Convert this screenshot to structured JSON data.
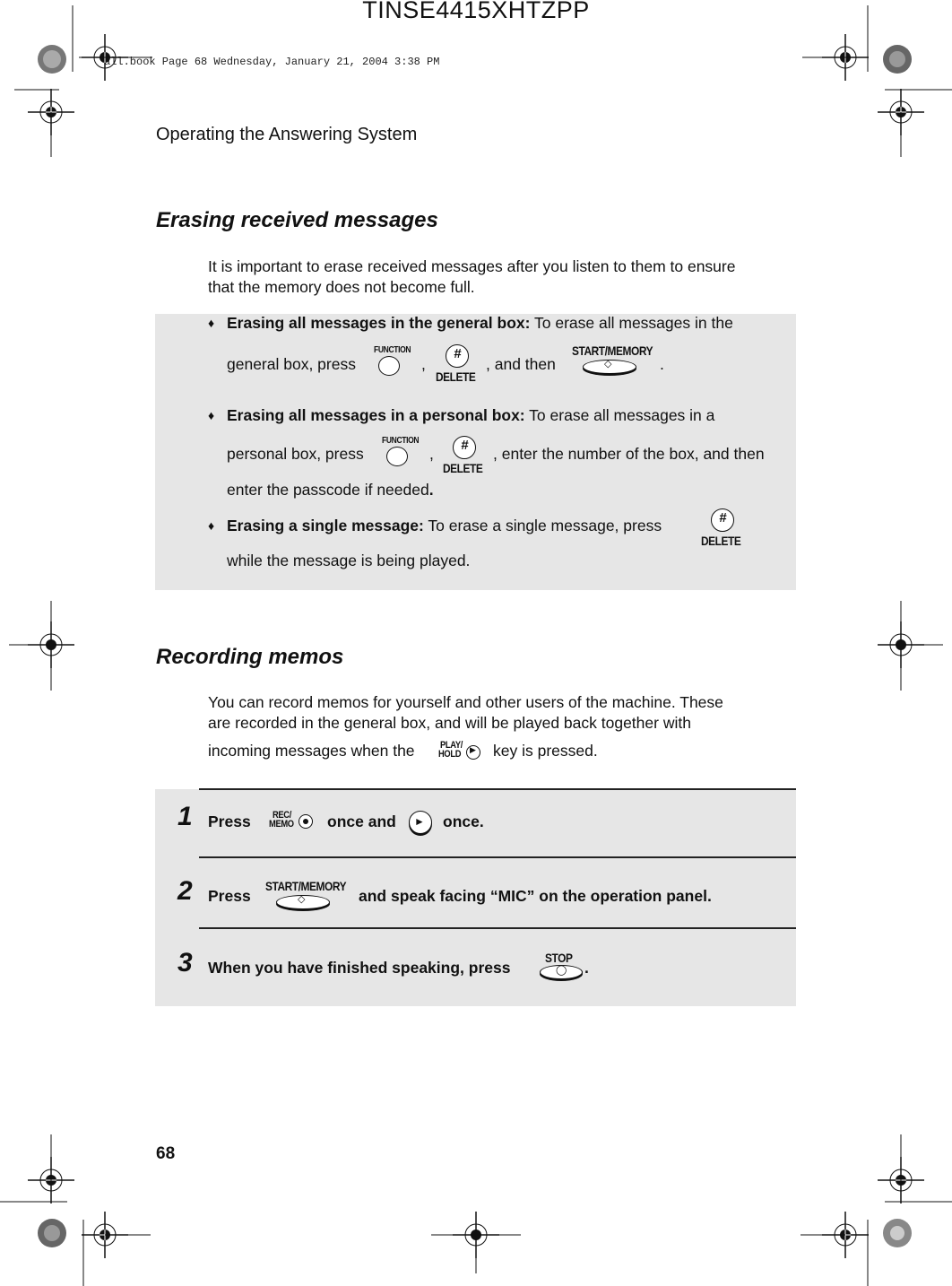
{
  "job_id": "TINSE4415XHTZPP",
  "book_line": "all.book  Page 68  Wednesday, January 21, 2004  3:38 PM",
  "running_head": "Operating the Answering System",
  "page_number": "68",
  "erasing": {
    "title": "Erasing received messages",
    "intro_line1": "It is important to erase received messages after you listen to them to ensure",
    "intro_line2": "that the memory does not become full.",
    "bullets": [
      {
        "bold": "Erasing all messages in the general box:",
        "text1": " To erase all messages in the",
        "text2": "general box, press",
        "sep1": ",",
        "sep2": ", and then",
        "end": "."
      },
      {
        "bold": "Erasing all messages in a personal box:",
        "text1": " To erase all messages in a",
        "text2": "personal box, press",
        "sep1": ",",
        "sep2": ", enter the number of the box, and then",
        "text3a": "enter the passcode if needed",
        "text3b": "."
      },
      {
        "bold": "Erasing a single message:",
        "text1": " To erase a single message, press",
        "text2": "while the message is being played."
      }
    ]
  },
  "recording": {
    "title": "Recording memos",
    "intro_line1": "You can record memos for yourself and other users of the machine. These",
    "intro_line2": "are recorded in the general box, and will be played back together with",
    "intro_line3a": "incoming messages when the",
    "intro_line3b": "key is pressed.",
    "steps": [
      {
        "num": "1",
        "a": "Press",
        "b": "once and",
        "c": "once."
      },
      {
        "num": "2",
        "a": "Press",
        "b": "and speak facing “MIC” on the operation panel."
      },
      {
        "num": "3",
        "a": "When you have finished speaking, press",
        "b": "."
      }
    ]
  },
  "keys": {
    "function": "FUNCTION",
    "delete": "DELETE",
    "hash": "#",
    "start_memory": "START/MEMORY",
    "play_hold_top": "PLAY/",
    "play_hold_bottom": "HOLD",
    "rec_memo_top": "REC/",
    "rec_memo_bottom": "MEMO",
    "stop": "STOP"
  }
}
